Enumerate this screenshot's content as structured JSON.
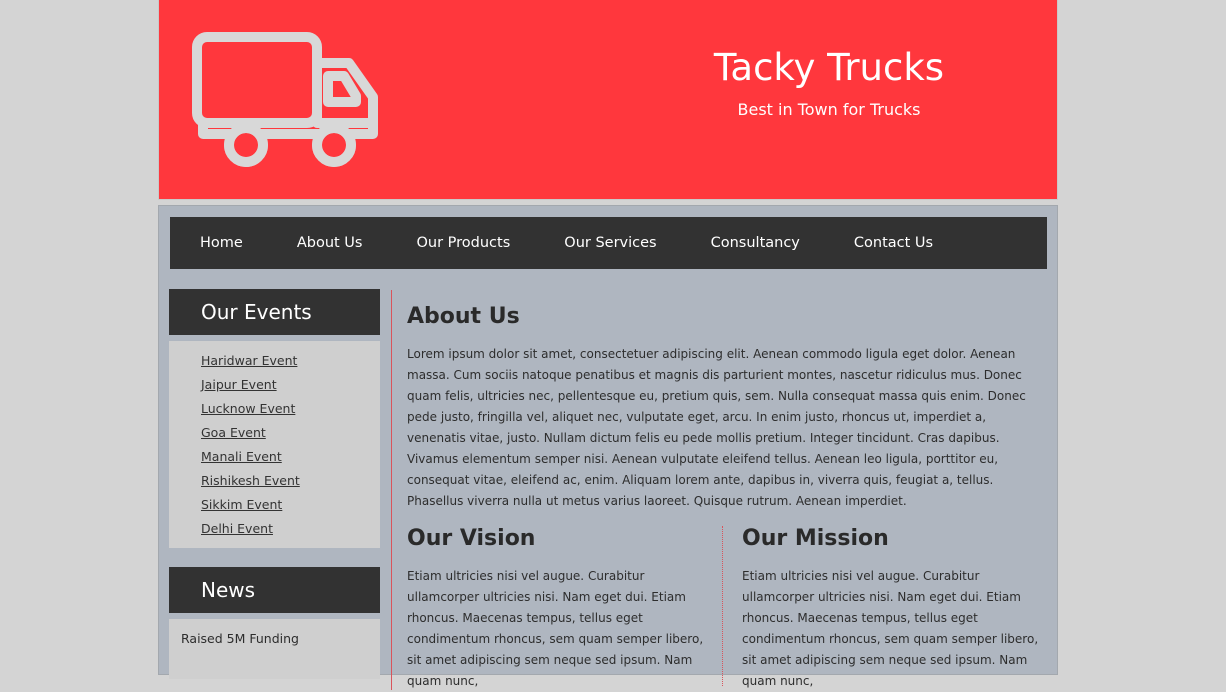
{
  "header": {
    "title": "Tacky Trucks",
    "tagline": "Best in Town for Trucks",
    "logo_icon": "truck-icon",
    "background_color": "#ff373d"
  },
  "nav": {
    "items": [
      {
        "label": "Home"
      },
      {
        "label": "About Us"
      },
      {
        "label": "Our Products"
      },
      {
        "label": "Our Services"
      },
      {
        "label": "Consultancy"
      },
      {
        "label": "Contact Us"
      }
    ]
  },
  "sidebar": {
    "events_title": "Our Events",
    "events": [
      {
        "label": "Haridwar Event"
      },
      {
        "label": "Jaipur Event"
      },
      {
        "label": "Lucknow Event"
      },
      {
        "label": "Goa Event"
      },
      {
        "label": "Manali Event"
      },
      {
        "label": "Rishikesh Event"
      },
      {
        "label": "Sikkim Event"
      },
      {
        "label": "Delhi Event"
      }
    ],
    "news_title": "News",
    "news": [
      {
        "label": "Raised 5M Funding"
      }
    ]
  },
  "main": {
    "about_title": "About Us",
    "about_text": "Lorem ipsum dolor sit amet, consectetuer adipiscing elit. Aenean commodo ligula eget dolor. Aenean massa. Cum sociis natoque penatibus et magnis dis parturient montes, nascetur ridiculus mus. Donec quam felis, ultricies nec, pellentesque eu, pretium quis, sem. Nulla consequat massa quis enim. Donec pede justo, fringilla vel, aliquet nec, vulputate eget, arcu. In enim justo, rhoncus ut, imperdiet a, venenatis vitae, justo. Nullam dictum felis eu pede mollis pretium. Integer tincidunt. Cras dapibus. Vivamus elementum semper nisi. Aenean vulputate eleifend tellus. Aenean leo ligula, porttitor eu, consequat vitae, eleifend ac, enim. Aliquam lorem ante, dapibus in, viverra quis, feugiat a, tellus. Phasellus viverra nulla ut metus varius laoreet. Quisque rutrum. Aenean imperdiet.",
    "vision_title": "Our Vision",
    "vision_text": "Etiam ultricies nisi vel augue. Curabitur ullamcorper ultricies nisi. Nam eget dui. Etiam rhoncus. Maecenas tempus, tellus eget condimentum rhoncus, sem quam semper libero, sit amet adipiscing sem neque sed ipsum. Nam quam nunc,",
    "mission_title": "Our Mission",
    "mission_text": "Etiam ultricies nisi vel augue. Curabitur ullamcorper ultricies nisi. Nam eget dui. Etiam rhoncus. Maecenas tempus, tellus eget condimentum rhoncus, sem quam semper libero, sit amet adipiscing sem neque sed ipsum. Nam quam nunc,"
  }
}
